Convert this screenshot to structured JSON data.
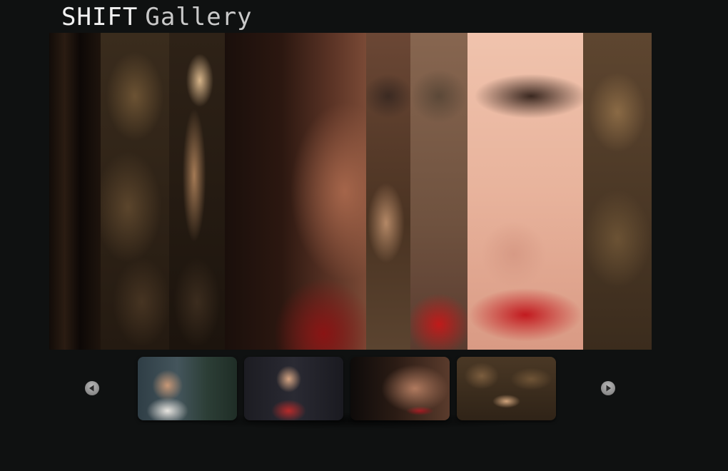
{
  "header": {
    "title_word1": "SHIFT",
    "title_word2": "Gallery"
  },
  "gallery": {
    "thumbnails": [
      {
        "name": "thumbnail-1"
      },
      {
        "name": "thumbnail-2"
      },
      {
        "name": "thumbnail-3"
      },
      {
        "name": "thumbnail-4"
      }
    ],
    "icons": {
      "prev": "arrow-left-circle-icon",
      "next": "arrow-right-circle-icon"
    },
    "colors": {
      "background": "#0f1111",
      "title_primary": "#f2f2f2",
      "title_secondary": "#c9c9c9",
      "nav_button": "#9a9a9a"
    }
  }
}
